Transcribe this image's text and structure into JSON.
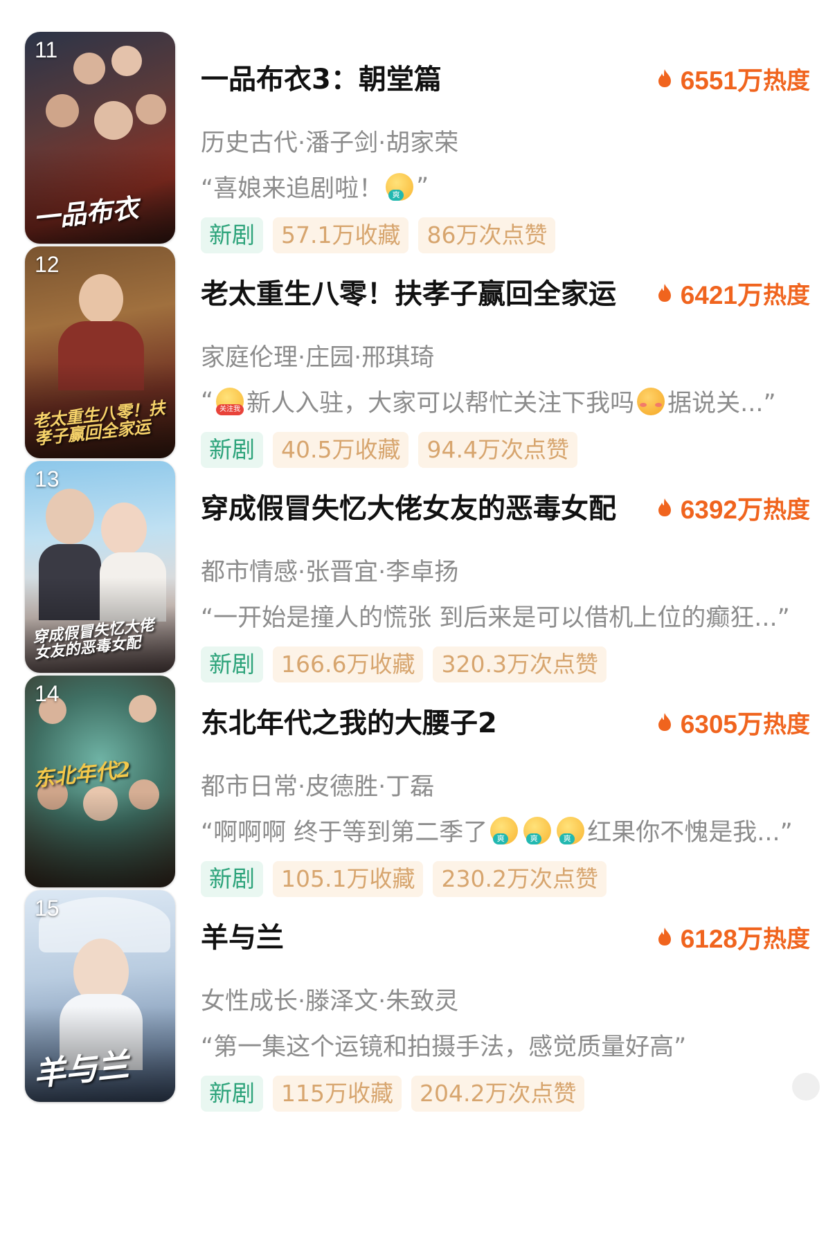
{
  "colors": {
    "heat": "#f0641e",
    "meta_text": "#8c8c8c",
    "new_tag_bg": "#e9f7f1",
    "new_tag_text": "#2ca37a",
    "stat_tag_bg": "#fdf3e7",
    "stat_tag_text": "#d7a56e"
  },
  "items": [
    {
      "rank": "11",
      "poster_text": "一品布衣",
      "title": "一品布衣3：朝堂篇",
      "heat_value": "6551万",
      "heat_suffix": "热度",
      "meta": "历史古代·潘子剑·胡家荣",
      "quote_start": "“喜娘来追剧啦！",
      "quote_end": "”",
      "tag_new": "新剧",
      "favorites": "57.1万收藏",
      "likes": "86万次点赞"
    },
    {
      "rank": "12",
      "poster_text": "老太重生八零！扶孝子赢回全家运",
      "title": "老太重生八零！扶孝子赢回全家运",
      "heat_value": "6421万",
      "heat_suffix": "热度",
      "meta": "家庭伦理·庄园·邢琪琦",
      "quote_start": "“",
      "quote_mid": "新人入驻，大家可以帮忙关注下我吗",
      "quote_end": "据说关...”",
      "tag_new": "新剧",
      "favorites": "40.5万收藏",
      "likes": "94.4万次点赞"
    },
    {
      "rank": "13",
      "poster_text": "穿成假冒失忆大佬女友的恶毒女配",
      "title": "穿成假冒失忆大佬女友的恶毒女配",
      "heat_value": "6392万",
      "heat_suffix": "热度",
      "meta": "都市情感·张晋宜·李卓扬",
      "quote_start": "“一开始是撞人的慌张 到后来是可以借机上位的癫狂...”",
      "tag_new": "新剧",
      "favorites": "166.6万收藏",
      "likes": "320.3万次点赞"
    },
    {
      "rank": "14",
      "poster_text": "东北年代2",
      "title": "东北年代之我的大腰子2",
      "heat_value": "6305万",
      "heat_suffix": "热度",
      "meta": "都市日常·皮德胜·丁磊",
      "quote_start": "“啊啊啊 终于等到第二季了",
      "quote_end": "红果你不愧是我...”",
      "tag_new": "新剧",
      "favorites": "105.1万收藏",
      "likes": "230.2万次点赞"
    },
    {
      "rank": "15",
      "poster_text": "羊与兰",
      "title": "羊与兰",
      "heat_value": "6128万",
      "heat_suffix": "热度",
      "meta": "女性成长·滕泽文·朱致灵",
      "quote_start": "“第一集这个运镜和拍摄手法，感觉质量好高”",
      "tag_new": "新剧",
      "favorites": "115万收藏",
      "likes": "204.2万次点赞"
    }
  ],
  "icons": {
    "heat": "flame-icon",
    "emoji_shuang": "爽",
    "emoji_follow": "关注我"
  }
}
